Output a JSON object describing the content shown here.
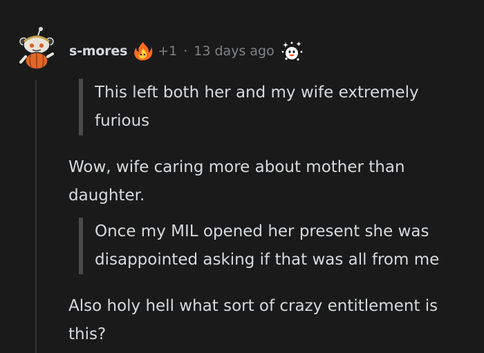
{
  "comment": {
    "username": "s-mores",
    "score": "+1",
    "separator": "·",
    "timestamp": "13 days ago",
    "avatar_icon": "snoo-avatar-icon",
    "flair_icon": "fire-flair-icon",
    "award_icon": "award-icon",
    "body": {
      "quote1": {
        "line1": "This left both her and my wife extremely",
        "line2": "furious"
      },
      "para1": {
        "line1": "Wow, wife caring more about mother than",
        "line2": "daughter."
      },
      "quote2": {
        "line1": "Once my MIL opened her present she was",
        "line2": "disappointed asking if that was all from me"
      },
      "para2": {
        "line1": "Also holy hell what sort of crazy entitlement is",
        "line2": "this?"
      }
    }
  },
  "colors": {
    "background": "#1a1a1b",
    "text": "#d7dadc",
    "meta": "#818384",
    "quote_bar": "#4a4b4c",
    "thread_line": "#343536"
  }
}
